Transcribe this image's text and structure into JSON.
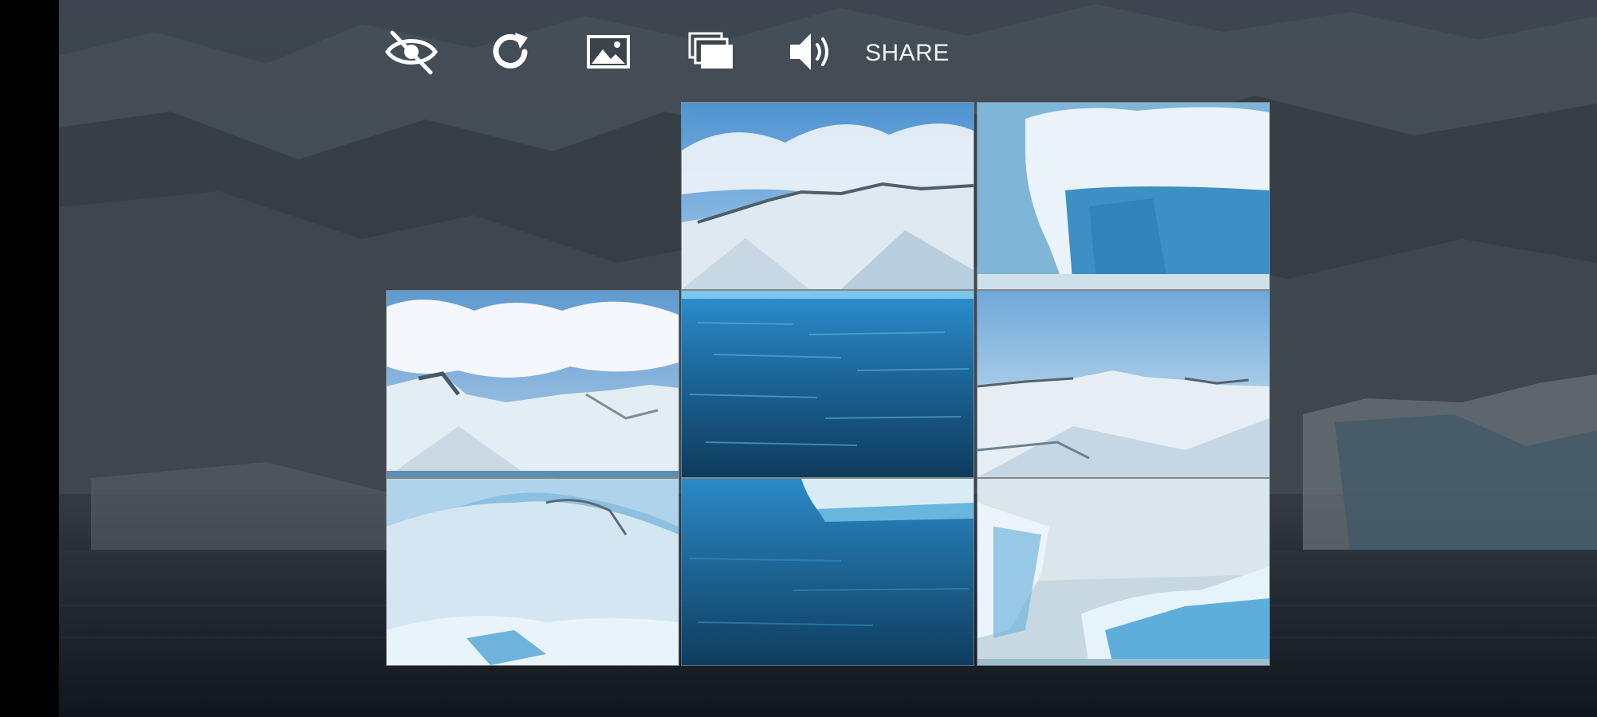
{
  "toolbar": {
    "hide_icon": "eye-off-icon",
    "reload_icon": "reload-icon",
    "image_icon": "image-icon",
    "gallery_icon": "gallery-stack-icon",
    "sound_icon": "speaker-icon",
    "share_label": "SHARE"
  },
  "colors": {
    "sky": "#5aa3dc",
    "ice": "#dbe8f0",
    "water": "#1a6a9c",
    "deep_water": "#0d3f63",
    "glacier_blue": "#4fa3cf",
    "backdrop": "#3b444c"
  },
  "puzzle": {
    "grid": "3x3",
    "empty_slot": "top-left",
    "tiles": [
      {
        "slot": "r1c2",
        "scene": "sky-snow-ridge"
      },
      {
        "slot": "r1c3",
        "scene": "iceberg-block"
      },
      {
        "slot": "r2c1",
        "scene": "clouds-snow-peaks"
      },
      {
        "slot": "r2c2",
        "scene": "open-water"
      },
      {
        "slot": "r2c3",
        "scene": "sky-snow-range"
      },
      {
        "slot": "r3c1",
        "scene": "glacier-slope"
      },
      {
        "slot": "r3c2",
        "scene": "water-ice-edge"
      },
      {
        "slot": "r3c3",
        "scene": "ice-field-blocks"
      }
    ]
  }
}
